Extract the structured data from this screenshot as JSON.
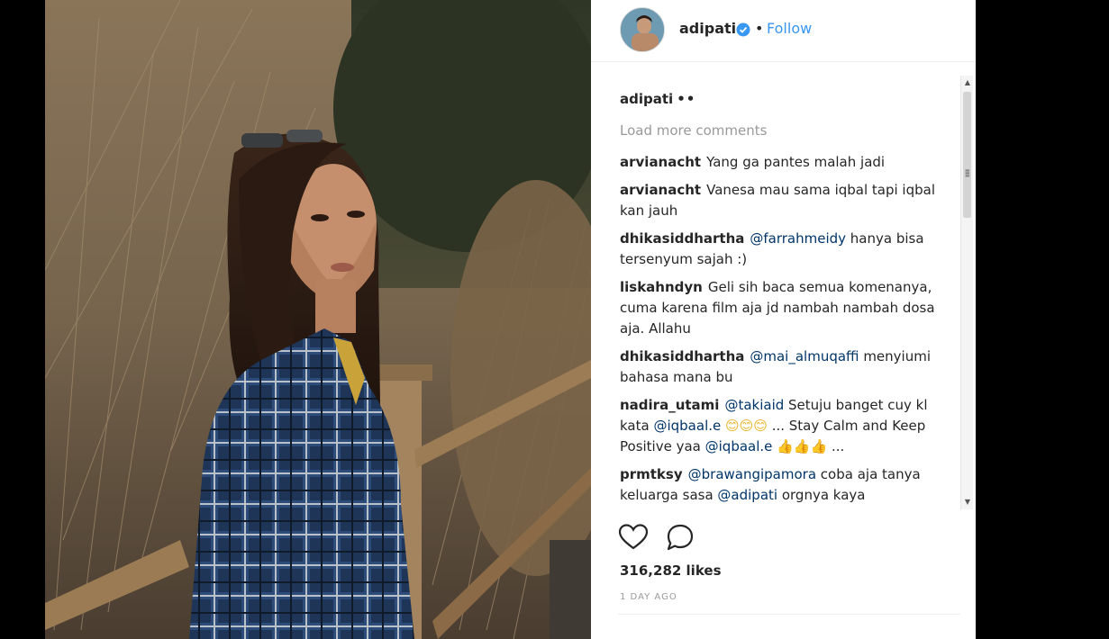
{
  "header": {
    "username": "adipati",
    "separator": "•",
    "follow_label": "Follow"
  },
  "caption": {
    "username": "adipati",
    "text": "••"
  },
  "load_more_label": "Load more comments",
  "comments": [
    {
      "user": "arvianacht",
      "parts": [
        {
          "t": "Yang ga pantes malah jadi"
        }
      ]
    },
    {
      "user": "arvianacht",
      "parts": [
        {
          "t": "Vanesa mau sama iqbal tapi iqbal kan jauh"
        }
      ]
    },
    {
      "user": "dhikasiddhartha",
      "parts": [
        {
          "m": "@farrahmeidy"
        },
        {
          "t": " hanya bisa tersenyum sajah :)"
        }
      ]
    },
    {
      "user": "liskahndyn",
      "parts": [
        {
          "t": "Geli sih baca semua komenanya, cuma karena film aja jd nambah nambah dosa aja. Allahu"
        }
      ]
    },
    {
      "user": "dhikasiddhartha",
      "parts": [
        {
          "m": "@mai_almuqaffi"
        },
        {
          "t": " menyiumi bahasa mana bu"
        }
      ]
    },
    {
      "user": "nadira_utami",
      "parts": [
        {
          "m": "@takiaid"
        },
        {
          "t": " Setuju banget cuy kl kata "
        },
        {
          "m": "@iqbaal.e"
        },
        {
          "e": " 😊😊😊"
        },
        {
          "t": " ... Stay Calm and Keep Positive yaa "
        },
        {
          "m": "@iqbaal.e"
        },
        {
          "e": " 👍👍👍"
        },
        {
          "t": " ..."
        }
      ]
    },
    {
      "user": "prmtksy",
      "parts": [
        {
          "m": "@brawangipamora"
        },
        {
          "t": " coba aja tanya keluarga sasa "
        },
        {
          "m": "@adipati"
        },
        {
          "t": " orgnya kaya"
        }
      ]
    }
  ],
  "likes_text": "316,282 likes",
  "time_text": "1 DAY AGO",
  "colors": {
    "link": "#3897f0",
    "mention": "#003569",
    "muted": "#999999",
    "text": "#262626"
  },
  "icons": {
    "like": "heart-icon",
    "comment": "comment-bubble-icon",
    "verified": "verified-badge-icon"
  }
}
